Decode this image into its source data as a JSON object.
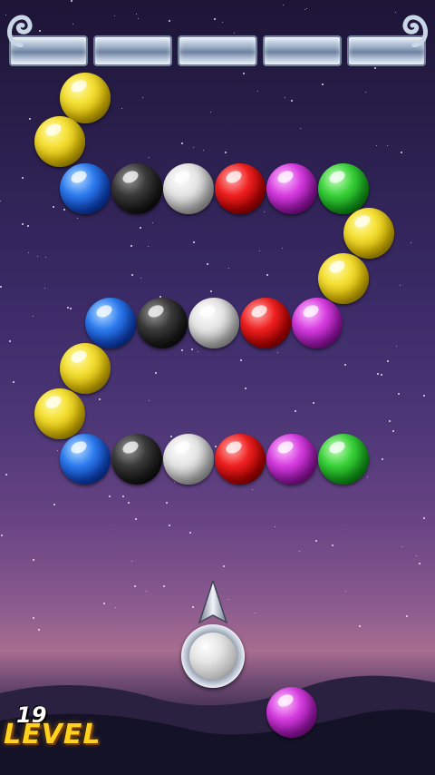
{
  "level": {
    "number": "19",
    "label": "LEVEL"
  },
  "colors": {
    "yellow": "#f6e23a",
    "blue": "#2d7cf0",
    "black": "#1a1a1a",
    "white": "#e4e4e4",
    "red": "#f02020",
    "purple": "#d63de0",
    "green": "#3ad23a"
  },
  "bubble_chain": [
    {
      "color": "yellow"
    },
    {
      "color": "yellow"
    },
    {
      "color": "blue"
    },
    {
      "color": "black"
    },
    {
      "color": "white"
    },
    {
      "color": "red"
    },
    {
      "color": "purple"
    },
    {
      "color": "green"
    },
    {
      "color": "yellow"
    },
    {
      "color": "yellow"
    },
    {
      "color": "purple"
    },
    {
      "color": "red"
    },
    {
      "color": "white"
    },
    {
      "color": "black"
    },
    {
      "color": "blue"
    },
    {
      "color": "yellow"
    },
    {
      "color": "yellow"
    },
    {
      "color": "blue"
    },
    {
      "color": "black"
    },
    {
      "color": "white"
    },
    {
      "color": "red"
    },
    {
      "color": "purple"
    },
    {
      "color": "green"
    }
  ],
  "shooter": {
    "loaded_color": "white"
  },
  "next_bubble": {
    "color": "purple"
  }
}
